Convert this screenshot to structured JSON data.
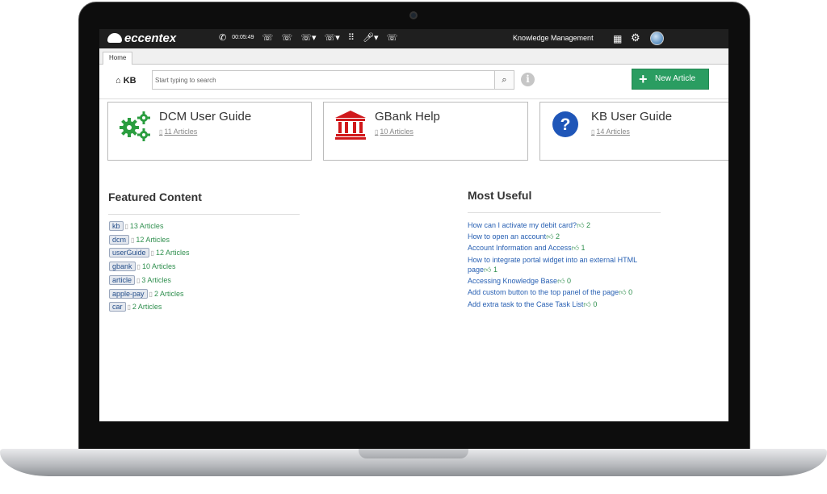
{
  "topbar": {
    "brand": "eccentex",
    "timer": "00:05:49",
    "module": "Knowledge Management"
  },
  "tabs": [
    "Home"
  ],
  "kb": {
    "title": "KB",
    "search_placeholder": "Start typing to search",
    "new_article_label": "New Article"
  },
  "cards": [
    {
      "title": "DCM User Guide",
      "count": "11 Articles",
      "icon": "gears-icon",
      "color": "#2a9d3f"
    },
    {
      "title": "GBank Help",
      "count": "10 Articles",
      "icon": "bank-icon",
      "color": "#d0181b"
    },
    {
      "title": "KB User Guide",
      "count": "14 Articles",
      "icon": "question-circle-icon",
      "color": "#1f56b8"
    }
  ],
  "featured": {
    "title": "Featured Content",
    "items": [
      {
        "tag": "kb",
        "count": "13 Articles"
      },
      {
        "tag": "dcm",
        "count": "12 Articles"
      },
      {
        "tag": "userGuide",
        "count": "12 Articles"
      },
      {
        "tag": "gbank",
        "count": "10 Articles"
      },
      {
        "tag": "article",
        "count": "3 Articles"
      },
      {
        "tag": "apple-pay",
        "count": "2 Articles"
      },
      {
        "tag": "car",
        "count": "2 Articles"
      }
    ]
  },
  "most_useful": {
    "title": "Most Useful",
    "items": [
      {
        "text": "How can I activate my debit card?",
        "likes": "2"
      },
      {
        "text": "How to open an account",
        "likes": "2"
      },
      {
        "text": "Account Information and Access",
        "likes": "1"
      },
      {
        "text": "How to integrate portal widget into an external HTML page",
        "likes": "1"
      },
      {
        "text": "Accessing Knowledge Base",
        "likes": "0"
      },
      {
        "text": "Add custom button to the top panel of the page",
        "likes": "0"
      },
      {
        "text": "Add extra task to the Case Task List",
        "likes": "0"
      }
    ]
  }
}
